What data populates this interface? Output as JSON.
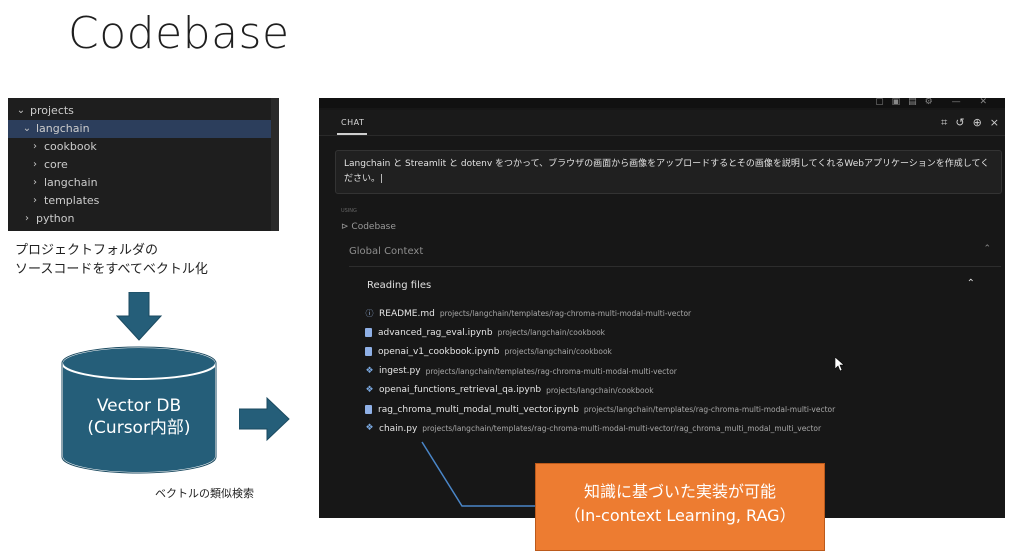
{
  "slide": {
    "title": "Codebase"
  },
  "explorer": {
    "items": [
      {
        "label": "projects",
        "expanded": true
      },
      {
        "label": "langchain",
        "expanded": true
      },
      {
        "label": "cookbook",
        "expanded": false
      },
      {
        "label": "core",
        "expanded": false
      },
      {
        "label": "langchain",
        "expanded": false
      },
      {
        "label": "templates",
        "expanded": false
      },
      {
        "label": "python",
        "expanded": false
      }
    ]
  },
  "captions": {
    "line1": "プロジェクトフォルダの",
    "line2": "ソースコードをすべてベクトル化",
    "search": "ベクトルの類似検索"
  },
  "vector_db": {
    "line1": "Vector DB",
    "line2": "(Cursor内部)"
  },
  "colors": {
    "db_blue": "#255e79",
    "orange": "#ed7c31"
  },
  "chat": {
    "tab_label": "CHAT",
    "prompt": "Langchain と Streamlit と dotenv をつかって、ブラウザの画面から画像をアップロードするとその画像を説明してくれるWebアプリケーションを作成してください。|",
    "using_label": "USING",
    "codebase_label": "Codebase",
    "global_context": "Global Context",
    "reading_files": "Reading files",
    "files": [
      {
        "icon": "info-icon",
        "name": "README.md",
        "path": "projects/langchain/templates/rag-chroma-multi-modal-multi-vector"
      },
      {
        "icon": "notebook-icon",
        "name": "advanced_rag_eval.ipynb",
        "path": "projects/langchain/cookbook"
      },
      {
        "icon": "notebook-icon",
        "name": "openai_v1_cookbook.ipynb",
        "path": "projects/langchain/cookbook"
      },
      {
        "icon": "python-icon",
        "name": "ingest.py",
        "path": "projects/langchain/templates/rag-chroma-multi-modal-multi-vector"
      },
      {
        "icon": "python-icon",
        "name": "openai_functions_retrieval_qa.ipynb",
        "path": "projects/langchain/cookbook"
      },
      {
        "icon": "notebook-icon",
        "name": "rag_chroma_multi_modal_multi_vector.ipynb",
        "path": "projects/langchain/templates/rag-chroma-multi-modal-multi-vector"
      },
      {
        "icon": "python-icon",
        "name": "chain.py",
        "path": "projects/langchain/templates/rag-chroma-multi-modal-multi-vector/rag_chroma_multi_modal_multi_vector"
      }
    ]
  },
  "annotation": {
    "line1": "知識に基づいた実装が可能",
    "line2": "（In-context Learning, RAG）"
  }
}
